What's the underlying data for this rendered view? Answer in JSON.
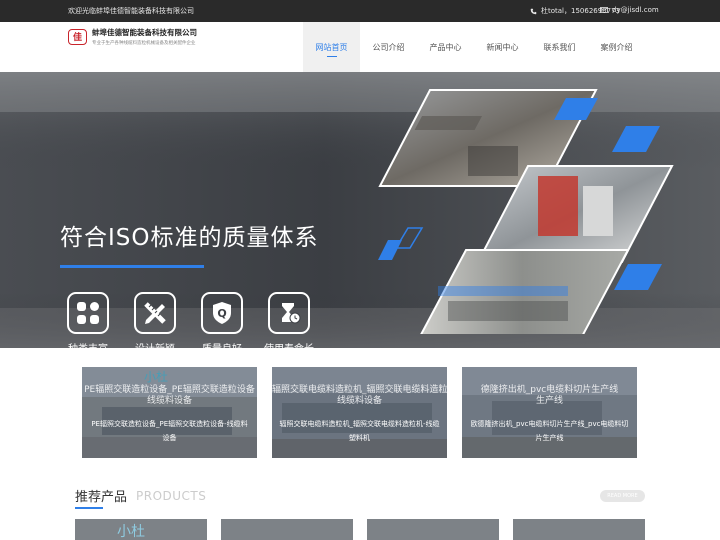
{
  "topbar": {
    "welcome": "欢迎光临蚌埠佳德智能装备科技有限公司",
    "phone": "杜total，15062690773",
    "email": "dy@jisdl.com"
  },
  "header": {
    "logo_mark": "佳",
    "company": "蚌埠佳德智能装备科技有限公司",
    "slogan": "专业于生产各种线缆料造粒机械设备及相关配件企业"
  },
  "nav": [
    {
      "label": "网站首页",
      "active": true
    },
    {
      "label": "公司介绍"
    },
    {
      "label": "产品中心"
    },
    {
      "label": "新闻中心"
    },
    {
      "label": "联系我们"
    },
    {
      "label": "案例介绍"
    }
  ],
  "banner": {
    "slogan": "符合ISO标准的质量体系",
    "features": [
      {
        "label": "种类丰富",
        "icon": "grid-icon"
      },
      {
        "label": "设计新颖",
        "icon": "pencil-ruler-icon"
      },
      {
        "label": "质量良好",
        "icon": "quality-q-icon"
      },
      {
        "label": "使用寿命长",
        "icon": "hourglass-icon"
      }
    ],
    "slide_count": 2,
    "active_slide": 2
  },
  "cards": [
    {
      "ghost_a": "PE辐照交联造粒设备_PE辐照交联造粒设备",
      "ghost_b": "线缆料设备",
      "title": "PE辐照交联造粒设备_PE辐照交联造粒设备-线缆料设备"
    },
    {
      "ghost_a": "辐照交联电缆料造粒机_辐照交联电缆料造粒机",
      "ghost_b": "线缆料设备",
      "title": "辐照交联电缆料造粒机_辐照交联电缆料造粒机-线缆塑料机"
    },
    {
      "ghost_a": "德隆挤出机_pvc电缆料切片生产线",
      "ghost_b": "生产线",
      "title": "欧德隆挤出机_pvc电缆料切片生产线_pvc电缆料切片生产线"
    }
  ],
  "recommend": {
    "title": "推荐产品",
    "subtitle": "PRODUCTS",
    "more": "READ MORE"
  },
  "colors": {
    "accent": "#2f7fe8",
    "topbar": "#2a2a2a",
    "banner": "#41454a",
    "logo_red": "#c8242b"
  }
}
